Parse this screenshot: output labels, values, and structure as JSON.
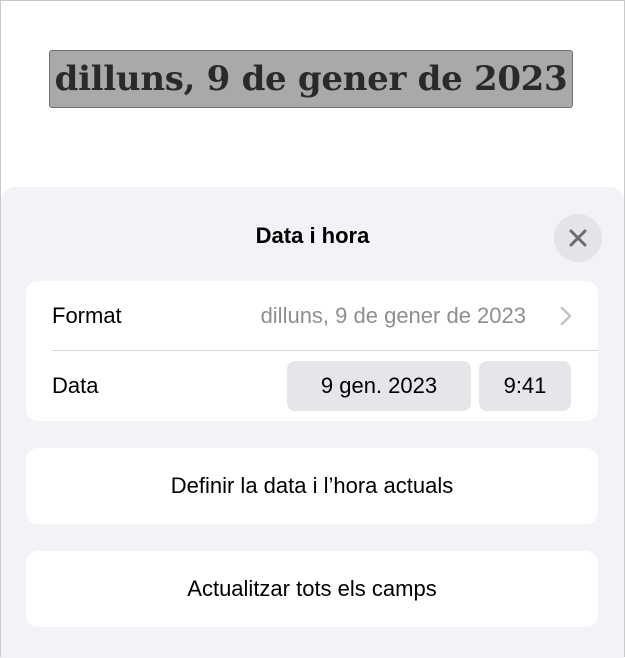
{
  "document": {
    "date_field_text": "dilluns, 9 de gener de 2023"
  },
  "sheet": {
    "title": "Data i hora",
    "close_icon": "xmark-icon",
    "format_row": {
      "label": "Format",
      "value": "dilluns, 9 de gener de 2023",
      "chevron_icon": "chevron-right-icon"
    },
    "date_row": {
      "label": "Data",
      "date_value": "9 gen. 2023",
      "time_value": "9:41"
    },
    "set_current_button": "Definir la data i l’hora actuals",
    "update_all_button": "Actualitzar tots els camps"
  },
  "colors": {
    "sheet_background": "#f2f2f7",
    "group_background": "#ffffff",
    "pill_background": "#e5e5ea",
    "secondary_text": "#8e8e93",
    "selected_field": "#a9a9a9"
  }
}
